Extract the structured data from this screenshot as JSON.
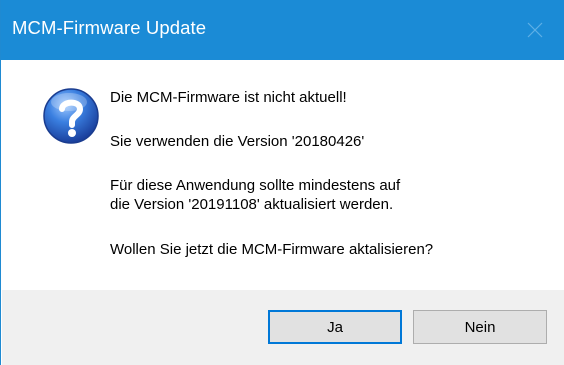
{
  "window": {
    "title": "MCM-Firmware Update",
    "accent_color": "#1b8bd6"
  },
  "icons": {
    "dialog_icon": "question-mark-icon",
    "close_icon": "close-icon"
  },
  "message": {
    "line1": "Die MCM-Firmware ist nicht aktuell!",
    "line2": "Sie verwenden die Version '20180426'",
    "line3a": "Für diese Anwendung sollte mindestens auf",
    "line3b": "die Version '20191108' aktualisiert werden.",
    "line4": "Wollen Sie jetzt die MCM-Firmware aktalisieren?"
  },
  "buttons": {
    "yes_label": "Ja",
    "no_label": "Nein"
  }
}
